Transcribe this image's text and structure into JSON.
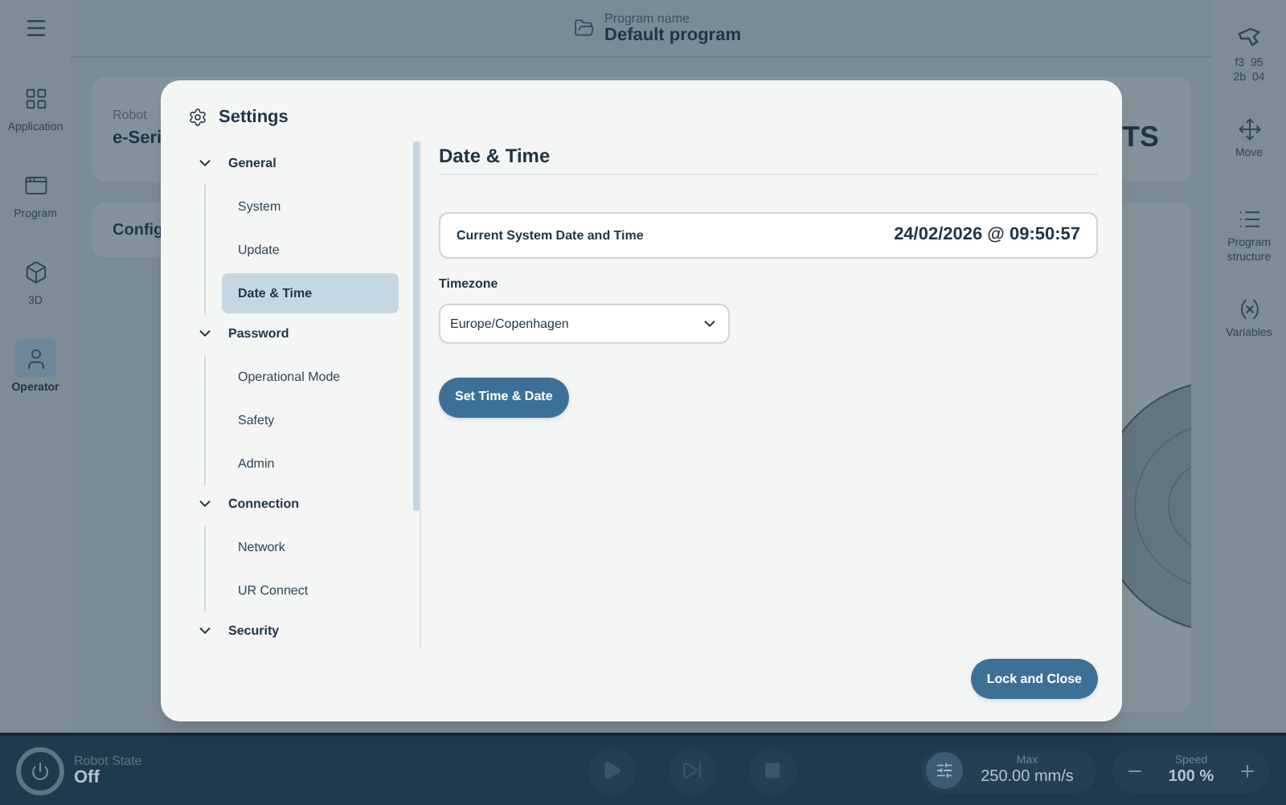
{
  "top_bar": {
    "program_label": "Program name",
    "program_name": "Default program"
  },
  "left_nav": [
    {
      "label": "Application",
      "selected": false
    },
    {
      "label": "Program",
      "selected": false
    },
    {
      "label": "3D",
      "selected": false
    },
    {
      "label": "Operator",
      "selected": true
    }
  ],
  "right_nav": {
    "device_code": [
      "f3  95",
      "2b  04"
    ],
    "items": [
      {
        "label": "Move"
      },
      {
        "label": "Program structure"
      },
      {
        "label": "Variables"
      }
    ]
  },
  "background": {
    "robot_label": "Robot",
    "robot_value": "e-Seri",
    "badge_text": "TS",
    "config_title": "Config"
  },
  "settings": {
    "title": "Settings",
    "nav": [
      {
        "label": "General",
        "expanded": true,
        "children": [
          {
            "label": "System",
            "selected": false
          },
          {
            "label": "Update",
            "selected": false
          },
          {
            "label": "Date & Time",
            "selected": true
          }
        ]
      },
      {
        "label": "Password",
        "expanded": true,
        "children": [
          {
            "label": "Operational Mode",
            "selected": false
          },
          {
            "label": "Safety",
            "selected": false
          },
          {
            "label": "Admin",
            "selected": false
          }
        ]
      },
      {
        "label": "Connection",
        "expanded": true,
        "children": [
          {
            "label": "Network",
            "selected": false
          },
          {
            "label": "UR Connect",
            "selected": false
          }
        ]
      },
      {
        "label": "Security",
        "expanded": true
      }
    ],
    "page_title": "Date & Time",
    "current_label": "Current System Date and Time",
    "current_value": "24/02/2026 @ 09:50:57",
    "timezone_label": "Timezone",
    "timezone_value": "Europe/Copenhagen",
    "set_button": "Set Time & Date",
    "close_button": "Lock and Close"
  },
  "bottom_bar": {
    "robot_state_label": "Robot State",
    "robot_state_value": "Off",
    "max_label": "Max",
    "max_value": "250.00 mm/s",
    "speed_label": "Speed",
    "speed_value": "100 %"
  }
}
